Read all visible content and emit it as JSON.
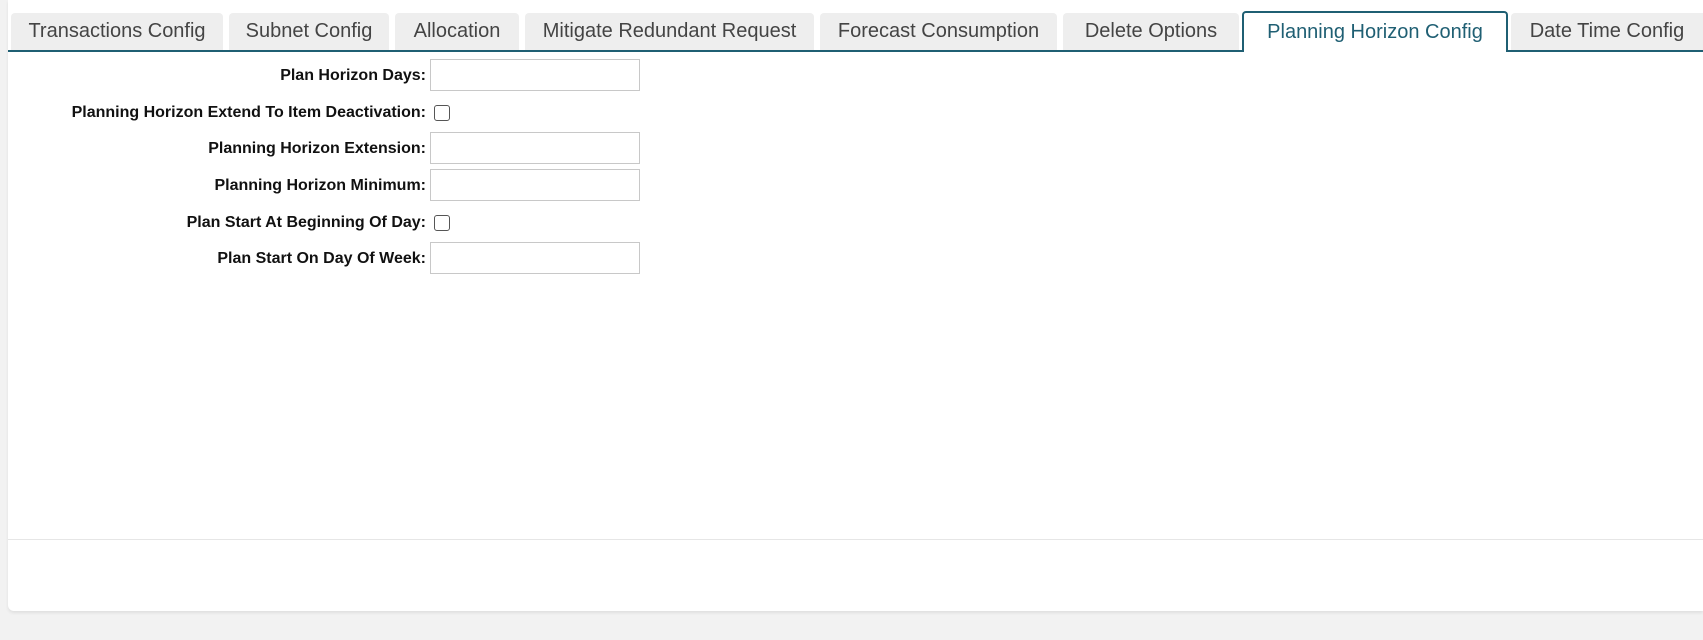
{
  "tabs": [
    {
      "label": "Transactions Config",
      "active": false
    },
    {
      "label": "Subnet Config",
      "active": false
    },
    {
      "label": "Allocation",
      "active": false
    },
    {
      "label": "Mitigate Redundant Request",
      "active": false
    },
    {
      "label": "Forecast Consumption",
      "active": false
    },
    {
      "label": "Delete Options",
      "active": false
    },
    {
      "label": "Planning Horizon Config",
      "active": true
    },
    {
      "label": "Date Time Config",
      "active": false
    }
  ],
  "form": {
    "plan_horizon_days": {
      "label": "Plan Horizon Days:",
      "value": ""
    },
    "extend_to_item_deactivation": {
      "label": "Planning Horizon Extend To Item Deactivation:",
      "checked": false
    },
    "planning_horizon_extension": {
      "label": "Planning Horizon Extension:",
      "value": ""
    },
    "planning_horizon_minimum": {
      "label": "Planning Horizon Minimum:",
      "value": ""
    },
    "plan_start_at_beginning_of_day": {
      "label": "Plan Start At Beginning Of Day:",
      "checked": false
    },
    "plan_start_on_day_of_week": {
      "label": "Plan Start On Day Of Week:",
      "value": ""
    }
  },
  "colors": {
    "accent": "#1f5f73",
    "tab_inactive_bg": "#eeeeee",
    "page_bg": "#f2f2f2"
  }
}
